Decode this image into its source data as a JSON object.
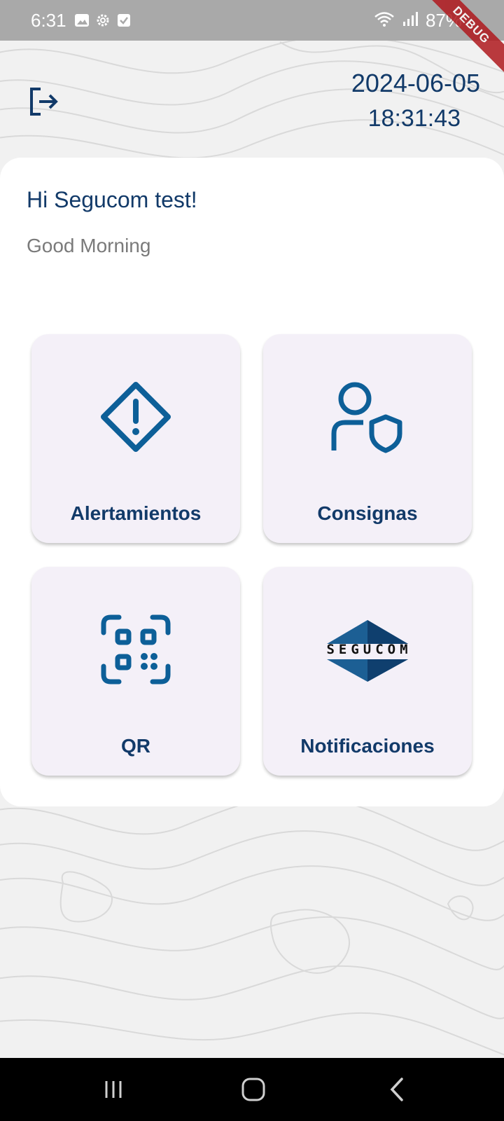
{
  "status_bar": {
    "time": "6:31",
    "battery": "87%",
    "icons_left": [
      "image-icon",
      "gear-icon",
      "checkbox-icon"
    ],
    "icons_right": [
      "wifi-icon",
      "signal-icon",
      "battery-icon"
    ]
  },
  "debug_banner": "DEBUG",
  "header": {
    "date": "2024-06-05",
    "time": "18:31:43"
  },
  "greeting": {
    "title": "Hi Segucom test!",
    "subtitle": "Good Morning"
  },
  "tiles": [
    {
      "label": "Alertamientos",
      "icon": "alert-diamond-icon"
    },
    {
      "label": "Consignas",
      "icon": "user-shield-icon"
    },
    {
      "label": "QR",
      "icon": "qr-scan-icon"
    },
    {
      "label": "Notificaciones",
      "icon": "segucom-logo"
    }
  ],
  "logo": {
    "text": "SEGUCOM"
  },
  "colors": {
    "primary_text": "#123a69",
    "icon_blue": "#0d5f98",
    "tile_bg": "#f4f0f8",
    "status_bar": "#a9a9a9",
    "debug": "#b0191e"
  },
  "navigation": [
    "recents-button",
    "home-button",
    "back-button"
  ]
}
